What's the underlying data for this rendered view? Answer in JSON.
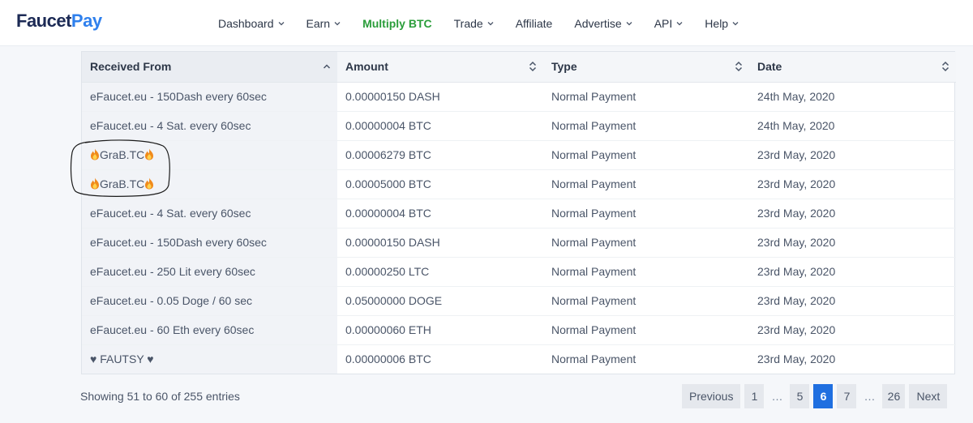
{
  "brand": {
    "part1": "Faucet",
    "part2": "Pay"
  },
  "nav": [
    {
      "label": "Dashboard",
      "dropdown": true,
      "active": false
    },
    {
      "label": "Earn",
      "dropdown": true,
      "active": false
    },
    {
      "label": "Multiply BTC",
      "dropdown": false,
      "active": true
    },
    {
      "label": "Trade",
      "dropdown": true,
      "active": false
    },
    {
      "label": "Affiliate",
      "dropdown": false,
      "active": false
    },
    {
      "label": "Advertise",
      "dropdown": true,
      "active": false
    },
    {
      "label": "API",
      "dropdown": true,
      "active": false
    },
    {
      "label": "Help",
      "dropdown": true,
      "active": false
    }
  ],
  "table": {
    "columns": [
      "Received From",
      "Amount",
      "Type",
      "Date"
    ],
    "rows": [
      {
        "from": "eFaucet.eu - 150Dash every 60sec",
        "amount": "0.00000150 DASH",
        "type": "Normal Payment",
        "date": "24th May, 2020",
        "flame": false
      },
      {
        "from": "eFaucet.eu - 4 Sat. every 60sec",
        "amount": "0.00000004 BTC",
        "type": "Normal Payment",
        "date": "24th May, 2020",
        "flame": false
      },
      {
        "from": "GraB.TC",
        "amount": "0.00006279 BTC",
        "type": "Normal Payment",
        "date": "23rd May, 2020",
        "flame": true
      },
      {
        "from": "GraB.TC",
        "amount": "0.00005000 BTC",
        "type": "Normal Payment",
        "date": "23rd May, 2020",
        "flame": true
      },
      {
        "from": "eFaucet.eu - 4 Sat. every 60sec",
        "amount": "0.00000004 BTC",
        "type": "Normal Payment",
        "date": "23rd May, 2020",
        "flame": false
      },
      {
        "from": "eFaucet.eu - 150Dash every 60sec",
        "amount": "0.00000150 DASH",
        "type": "Normal Payment",
        "date": "23rd May, 2020",
        "flame": false
      },
      {
        "from": "eFaucet.eu - 250 Lit every 60sec",
        "amount": "0.00000250 LTC",
        "type": "Normal Payment",
        "date": "23rd May, 2020",
        "flame": false
      },
      {
        "from": "eFaucet.eu - 0.05 Doge / 60 sec",
        "amount": "0.05000000 DOGE",
        "type": "Normal Payment",
        "date": "23rd May, 2020",
        "flame": false
      },
      {
        "from": "eFaucet.eu - 60 Eth every 60sec",
        "amount": "0.00000060 ETH",
        "type": "Normal Payment",
        "date": "23rd May, 2020",
        "flame": false
      },
      {
        "from": "♥ FAUTSY ♥",
        "amount": "0.00000006 BTC",
        "type": "Normal Payment",
        "date": "23rd May, 2020",
        "flame": false
      }
    ]
  },
  "footer": {
    "info": "Showing 51 to 60 of 255 entries",
    "pagination": [
      {
        "label": "Previous",
        "kind": "nav"
      },
      {
        "label": "1",
        "kind": "num"
      },
      {
        "label": "…",
        "kind": "ell"
      },
      {
        "label": "5",
        "kind": "num"
      },
      {
        "label": "6",
        "kind": "num",
        "active": true
      },
      {
        "label": "7",
        "kind": "num"
      },
      {
        "label": "…",
        "kind": "ell"
      },
      {
        "label": "26",
        "kind": "wide"
      },
      {
        "label": "Next",
        "kind": "nav"
      }
    ]
  },
  "colors": {
    "brand_dark": "#1c2a55",
    "brand_blue": "#2f80ed",
    "nav_active": "#2a9d3a",
    "page_active": "#1f6fe0"
  },
  "icons": {
    "nav_dropdown": "chevron-down-icon",
    "sort_asc": "sort-asc-icon",
    "sort_both": "sort-icon",
    "flame": "fire-emoji-icon"
  }
}
